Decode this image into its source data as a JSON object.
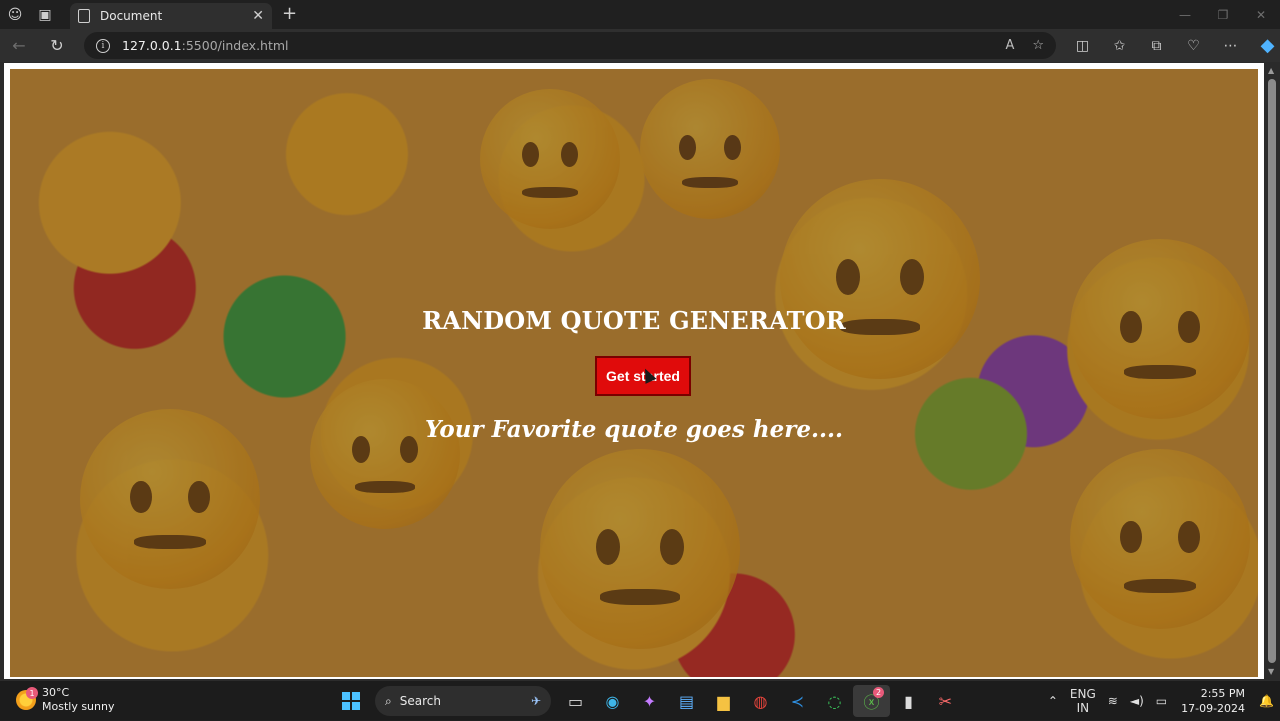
{
  "browser": {
    "tab_title": "Document",
    "url_host": "127.0.0.1",
    "url_path": ":5500/index.html"
  },
  "page": {
    "title": "RANDOM QUOTE GENERATOR",
    "button_label": "Get started",
    "quote": "Your Favorite quote goes here...."
  },
  "taskbar": {
    "weather_temp": "30°C",
    "weather_desc": "Mostly sunny",
    "weather_badge": "1",
    "search_label": "Search",
    "xbox_badge": "2",
    "lang_top": "ENG",
    "lang_bottom": "IN",
    "time": "2:55 PM",
    "date": "17-09-2024"
  },
  "colors": {
    "accent_button": "#e00b0b",
    "windows_blue": "#4cc2ff"
  }
}
